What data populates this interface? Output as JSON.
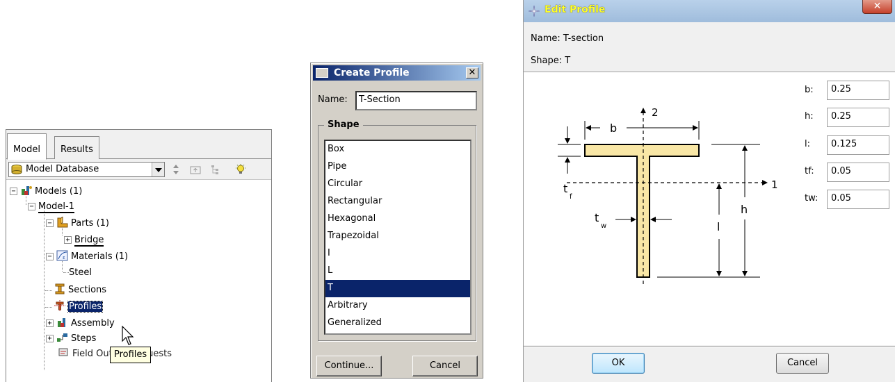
{
  "tree_panel": {
    "tabs": [
      "Model",
      "Results"
    ],
    "active_tab": "Model",
    "database_label": "Model Database",
    "nodes": {
      "models": "Models (1)",
      "model1": "Model-1",
      "parts": "Parts (1)",
      "bridge": "Bridge",
      "materials": "Materials (1)",
      "steel": "Steel",
      "sections": "Sections",
      "profiles": "Profiles",
      "assembly": "Assembly",
      "steps": "Steps",
      "field_output": "Field Output Requests"
    },
    "tooltip": "Profiles"
  },
  "create_profile": {
    "title": "Create Profile",
    "close_glyph": "✕",
    "name_label": "Name:",
    "name_value": "T-Section",
    "shape_legend": "Shape",
    "shapes": [
      "Box",
      "Pipe",
      "Circular",
      "Rectangular",
      "Hexagonal",
      "Trapezoidal",
      "I",
      "L",
      "T",
      "Arbitrary",
      "Generalized"
    ],
    "selected_shape": "T",
    "continue_label": "Continue...",
    "cancel_label": "Cancel"
  },
  "edit_profile": {
    "title": "Edit Profile",
    "close_glyph": "✕",
    "name_line": "Name:  T-section",
    "shape_line": "Shape:  T",
    "params": [
      {
        "label": "b:",
        "value": "0.25"
      },
      {
        "label": "h:",
        "value": "0.25"
      },
      {
        "label": "l:",
        "value": "0.125"
      },
      {
        "label": "tf:",
        "value": "0.05"
      },
      {
        "label": "tw:",
        "value": "0.05"
      }
    ],
    "diagram_labels": {
      "axis2": "2",
      "axis1": "1",
      "b": "b",
      "h": "h",
      "l": "l",
      "tf": "t",
      "tf_sub": "f",
      "tw": "t",
      "tw_sub": "w"
    },
    "ok_label": "OK",
    "cancel_label": "Cancel"
  },
  "colors": {
    "xp_title": "#0a246a",
    "selection": "#0a246a",
    "section_fill": "#f9e7a6",
    "tooltip_bg": "#ffffe1",
    "edit_title_text": "#ffff2a"
  }
}
